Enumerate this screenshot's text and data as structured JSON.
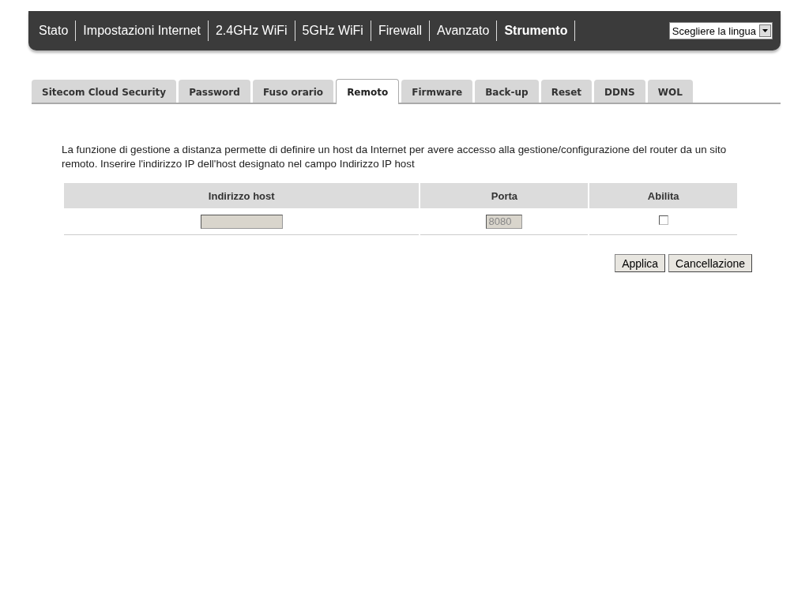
{
  "nav": [
    {
      "label": "Stato",
      "selected": false
    },
    {
      "label": "Impostazioni Internet",
      "selected": false
    },
    {
      "label": "2.4GHz WiFi",
      "selected": false
    },
    {
      "label": "5GHz WiFi",
      "selected": false
    },
    {
      "label": "Firewall",
      "selected": false
    },
    {
      "label": "Avanzato",
      "selected": false
    },
    {
      "label": "Strumento",
      "selected": true
    }
  ],
  "language_select": {
    "value": "Scegliere la lingua"
  },
  "tabs": [
    {
      "label": "Sitecom Cloud Security",
      "selected": false
    },
    {
      "label": "Password",
      "selected": false
    },
    {
      "label": "Fuso orario",
      "selected": false
    },
    {
      "label": "Remoto",
      "selected": true
    },
    {
      "label": "Firmware",
      "selected": false
    },
    {
      "label": "Back-up",
      "selected": false
    },
    {
      "label": "Reset",
      "selected": false
    },
    {
      "label": "DDNS",
      "selected": false
    },
    {
      "label": "WOL",
      "selected": false
    }
  ],
  "description": "La funzione di gestione a distanza permette di definire un host da Internet per avere accesso alla gestione/configurazione del router da un sito remoto. Inserire l'indirizzo IP dell'host designato nel campo Indirizzo IP host",
  "table": {
    "columns": [
      "Indirizzo host",
      "Porta",
      "Abilita"
    ],
    "host_field": {
      "disabled": true
    },
    "port_field": {
      "value": "8080",
      "disabled": true
    },
    "enable": {
      "checked": false
    }
  },
  "buttons": [
    "Applica",
    "Cancellazione"
  ]
}
